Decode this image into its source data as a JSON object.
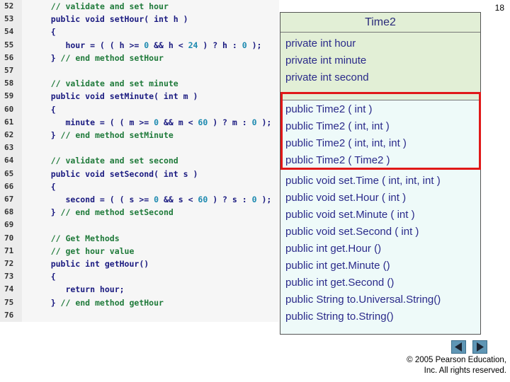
{
  "page_number": "18",
  "code_lines": [
    {
      "num": "52",
      "parts": [
        {
          "t": "    ",
          "c": ""
        },
        {
          "t": "// validate and set hour",
          "c": "c"
        }
      ]
    },
    {
      "num": "53",
      "parts": [
        {
          "t": "    public void setHour( int h )",
          "c": "k"
        }
      ]
    },
    {
      "num": "54",
      "parts": [
        {
          "t": "    {",
          "c": "k"
        }
      ]
    },
    {
      "num": "55",
      "parts": [
        {
          "t": "       hour = ( ( h >= ",
          "c": "k"
        },
        {
          "t": "0",
          "c": "n"
        },
        {
          "t": " && h < ",
          "c": "k"
        },
        {
          "t": "24",
          "c": "n"
        },
        {
          "t": " ) ? h : ",
          "c": "k"
        },
        {
          "t": "0",
          "c": "n"
        },
        {
          "t": " );",
          "c": "k"
        }
      ]
    },
    {
      "num": "56",
      "parts": [
        {
          "t": "    } ",
          "c": "k"
        },
        {
          "t": "// end method setHour",
          "c": "c"
        }
      ]
    },
    {
      "num": "57",
      "parts": [
        {
          "t": "",
          "c": ""
        }
      ]
    },
    {
      "num": "58",
      "parts": [
        {
          "t": "    ",
          "c": ""
        },
        {
          "t": "// validate and set minute",
          "c": "c"
        }
      ]
    },
    {
      "num": "59",
      "parts": [
        {
          "t": "    public void setMinute( int m )",
          "c": "k"
        }
      ]
    },
    {
      "num": "60",
      "parts": [
        {
          "t": "    {",
          "c": "k"
        }
      ]
    },
    {
      "num": "61",
      "parts": [
        {
          "t": "       minute = ( ( m >= ",
          "c": "k"
        },
        {
          "t": "0",
          "c": "n"
        },
        {
          "t": " && m < ",
          "c": "k"
        },
        {
          "t": "60",
          "c": "n"
        },
        {
          "t": " ) ? m : ",
          "c": "k"
        },
        {
          "t": "0",
          "c": "n"
        },
        {
          "t": " );",
          "c": "k"
        }
      ]
    },
    {
      "num": "62",
      "parts": [
        {
          "t": "    } ",
          "c": "k"
        },
        {
          "t": "// end method setMinute",
          "c": "c"
        }
      ]
    },
    {
      "num": "63",
      "parts": [
        {
          "t": "",
          "c": ""
        }
      ]
    },
    {
      "num": "64",
      "parts": [
        {
          "t": "    ",
          "c": ""
        },
        {
          "t": "// validate and set second",
          "c": "c"
        }
      ]
    },
    {
      "num": "65",
      "parts": [
        {
          "t": "    public void setSecond( int s )",
          "c": "k"
        }
      ]
    },
    {
      "num": "66",
      "parts": [
        {
          "t": "    {",
          "c": "k"
        }
      ]
    },
    {
      "num": "67",
      "parts": [
        {
          "t": "       second = ( ( s >= ",
          "c": "k"
        },
        {
          "t": "0",
          "c": "n"
        },
        {
          "t": " && s < ",
          "c": "k"
        },
        {
          "t": "60",
          "c": "n"
        },
        {
          "t": " ) ? s : ",
          "c": "k"
        },
        {
          "t": "0",
          "c": "n"
        },
        {
          "t": " );",
          "c": "k"
        }
      ]
    },
    {
      "num": "68",
      "parts": [
        {
          "t": "    } ",
          "c": "k"
        },
        {
          "t": "// end method setSecond",
          "c": "c"
        }
      ]
    },
    {
      "num": "69",
      "parts": [
        {
          "t": "",
          "c": ""
        }
      ]
    },
    {
      "num": "70",
      "parts": [
        {
          "t": "    ",
          "c": ""
        },
        {
          "t": "// Get Methods",
          "c": "c"
        }
      ]
    },
    {
      "num": "71",
      "parts": [
        {
          "t": "    ",
          "c": ""
        },
        {
          "t": "// get hour value",
          "c": "c"
        }
      ]
    },
    {
      "num": "72",
      "parts": [
        {
          "t": "    public int getHour()",
          "c": "k"
        }
      ]
    },
    {
      "num": "73",
      "parts": [
        {
          "t": "    {",
          "c": "k"
        }
      ]
    },
    {
      "num": "74",
      "parts": [
        {
          "t": "       return hour;",
          "c": "k"
        }
      ]
    },
    {
      "num": "75",
      "parts": [
        {
          "t": "    } ",
          "c": "k"
        },
        {
          "t": "// end method getHour",
          "c": "c"
        }
      ]
    },
    {
      "num": "76",
      "parts": [
        {
          "t": "",
          "c": ""
        }
      ]
    }
  ],
  "uml": {
    "title": "Time2",
    "fields": [
      "private int hour",
      "private int minute",
      "private int second"
    ],
    "constructors": [
      "public Time2 ( int )",
      "public Time2 ( int, int )",
      "public Time2 ( int, int, int )",
      "public Time2 ( Time2 )"
    ],
    "methods": [
      "public void set.Time ( int, int, int )",
      "public void set.Hour ( int )",
      "public void set.Minute ( int )",
      "public void set.Second ( int )",
      "public int get.Hour ()",
      "public int get.Minute ()",
      "public int get.Second ()",
      "public String to.Universal.String()",
      "public String to.String()"
    ]
  },
  "nav": {
    "prev_icon": "triangle-left-icon",
    "next_icon": "triangle-right-icon"
  },
  "copyright": {
    "line1": "© 2005 Pearson Education,",
    "line2": "Inc.  All rights reserved."
  },
  "colors": {
    "highlight": "#e01818",
    "uml_text": "#2a2a8a",
    "nav_button": "#5f96b5"
  }
}
